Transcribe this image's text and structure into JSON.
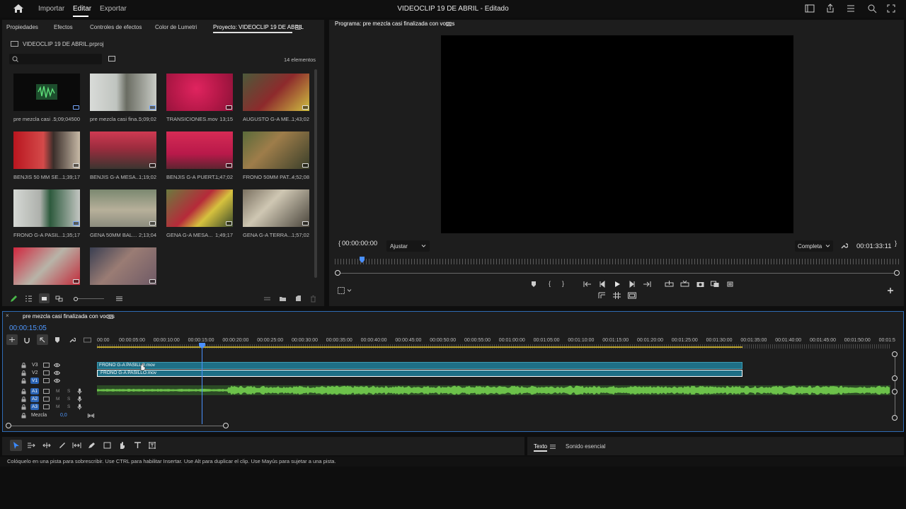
{
  "header": {
    "title": "VIDEOCLIP 19 DE ABRIL - Editado",
    "menus": [
      "Importar",
      "Editar",
      "Exportar"
    ],
    "active_menu": "Editar"
  },
  "project_panel": {
    "tabs": [
      "Propiedades",
      "Efectos",
      "Controles de efectos",
      "Color de Lumetri",
      "Proyecto: VIDEOCLIP 19 DE ABRIL"
    ],
    "file_name": "VIDEOCLIP 19 DE ABRIL.prproj",
    "search_placeholder": "",
    "item_count": "14 elementos",
    "items": [
      {
        "name": "pre mezcla casi ...",
        "duration": "5;09;04500"
      },
      {
        "name": "pre mezcla casi fina...",
        "duration": "5;09;02"
      },
      {
        "name": "TRANSICIONES.mov",
        "duration": "13;15"
      },
      {
        "name": "AUGUSTO G-A ME...",
        "duration": "1;43;02"
      },
      {
        "name": "BENJIS 50 MM SE...",
        "duration": "1;39;17"
      },
      {
        "name": "BENJIS G-A MESA...",
        "duration": "1;19;02"
      },
      {
        "name": "BENJIS G-A PUERT...",
        "duration": "1;47;02"
      },
      {
        "name": "FRONO 50MM PAT...",
        "duration": "4;52;08"
      },
      {
        "name": "FRONO G-A PASIL...",
        "duration": "1;35;17"
      },
      {
        "name": "GENA 50MM BAL...",
        "duration": "2;13;04"
      },
      {
        "name": "GENA G-A MESA...",
        "duration": "1;49;17"
      },
      {
        "name": "GENA G-A TERRA...",
        "duration": "1;57;02"
      },
      {
        "name": "",
        "duration": ""
      },
      {
        "name": "",
        "duration": ""
      }
    ]
  },
  "program_panel": {
    "title": "Programa: pre mezcla casi finalizada con voces",
    "timecode_left": "00:00:00:00",
    "fit_label": "Ajustar",
    "quality_label": "Completa",
    "timecode_right": "00:01:33:11"
  },
  "timeline": {
    "sequence_name": "pre mezcla casi finalizada con voces",
    "playhead_time": "00:00:15:05",
    "ruler_labels": [
      "00:00",
      "00:00:05:00",
      "00:00:10:00",
      "00:00:15:00",
      "00:00:20:00",
      "00:00:25:00",
      "00:00:30:00",
      "00:00:35:00",
      "00:00:40:00",
      "00:00:45:00",
      "00:00:50:00",
      "00:00:55:00",
      "00:01:00:00",
      "00:01:05:00",
      "00:01:10:00",
      "00:01:15:00",
      "00:01:20:00",
      "00:01:25:00",
      "00:01:30:00",
      "00:01:35:00",
      "00:01:40:00",
      "00:01:45:00",
      "00:01:50:00",
      "00:01:5"
    ],
    "video_tracks": [
      "V3",
      "V2",
      "V1"
    ],
    "audio_tracks": [
      "A1",
      "A2",
      "A3"
    ],
    "track_buttons": {
      "mute": "M",
      "solo": "S"
    },
    "mix_label": "Mezcla",
    "mix_value": "0,0",
    "clip_v3": "FRONO G-A PASILLO.mov",
    "clip_v2": "FRONO G-A PASILLO.mov"
  },
  "text_panel": {
    "tabs": [
      "Texto",
      "Sonido esencial"
    ]
  },
  "status_bar": {
    "message": "Colóquelo en una pista para sobrescribir. Use CTRL para habilitar Insertar. Use Alt para duplicar el clip. Use Mayús para sujetar a una pista."
  },
  "colors": {
    "accent": "#2f6bb4",
    "playhead": "#4a90ff",
    "clip": "#1e6f86",
    "audio": "#5aa83a"
  }
}
